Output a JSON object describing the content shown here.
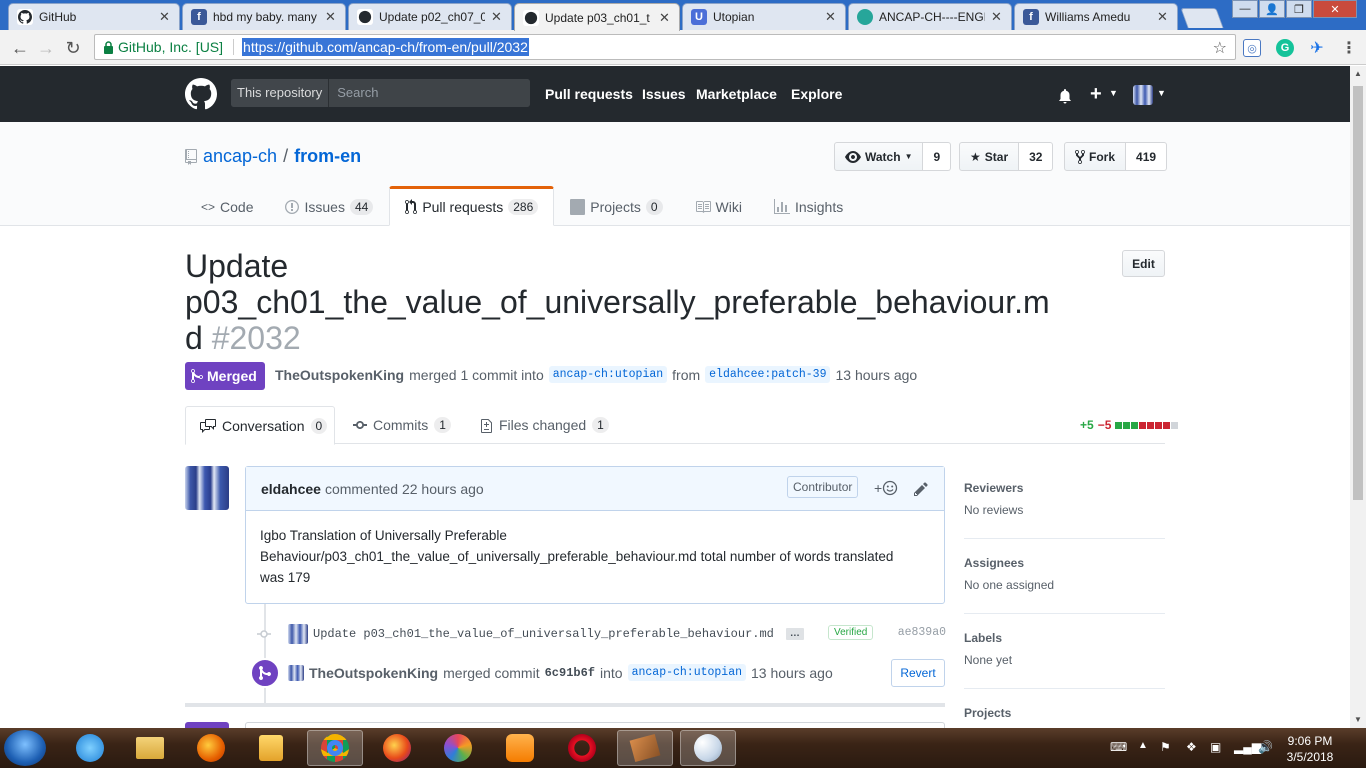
{
  "browser": {
    "tabs": [
      {
        "title": "GitHub",
        "icon": "github-icon"
      },
      {
        "title": "hbd my baby. many",
        "icon": "facebook-icon"
      },
      {
        "title": "Update p02_ch07_0",
        "icon": "github-icon"
      },
      {
        "title": "Update p03_ch01_t",
        "icon": "github-icon",
        "active": true
      },
      {
        "title": "Utopian",
        "icon": "utopian-icon"
      },
      {
        "title": "ANCAP-CH----ENGI",
        "icon": "ancap-icon"
      },
      {
        "title": "Williams Amedu",
        "icon": "facebook-icon"
      }
    ],
    "org": "GitHub, Inc. [US]",
    "url": "https://github.com/ancap-ch/from-en/pull/2032"
  },
  "header": {
    "scope": "This repository",
    "search_placeholder": "Search",
    "nav": [
      "Pull requests",
      "Issues",
      "Marketplace",
      "Explore"
    ]
  },
  "repo": {
    "owner": "ancap-ch",
    "name": "from-en",
    "watch": {
      "label": "Watch",
      "count": "9"
    },
    "star": {
      "label": "Star",
      "count": "32"
    },
    "fork": {
      "label": "Fork",
      "count": "419"
    },
    "nav": [
      {
        "label": "Code",
        "count": null
      },
      {
        "label": "Issues",
        "count": "44"
      },
      {
        "label": "Pull requests",
        "count": "286"
      },
      {
        "label": "Projects",
        "count": "0"
      },
      {
        "label": "Wiki",
        "count": null
      },
      {
        "label": "Insights",
        "count": null
      }
    ]
  },
  "pr": {
    "title_line1": "Update",
    "title_line2": "p03_ch01_the_value_of_universally_preferable_behaviour.m",
    "title_line3": "d",
    "number": "#2032",
    "edit_label": "Edit",
    "state": "Merged",
    "merger": "TheOutspokenKing",
    "merged_text": "merged 1 commit into",
    "base": "ancap-ch:utopian",
    "from_text": "from",
    "head": "eldahcee:patch-39",
    "time": "13 hours ago",
    "tabs": [
      {
        "label": "Conversation",
        "count": "0"
      },
      {
        "label": "Commits",
        "count": "1"
      },
      {
        "label": "Files changed",
        "count": "1"
      }
    ],
    "additions": "+5",
    "deletions": "−5",
    "diff_blocks": [
      "#28a745",
      "#28a745",
      "#28a745",
      "#cb2431",
      "#cb2431",
      "#cb2431",
      "#cb2431",
      "#d1d5da"
    ]
  },
  "comment": {
    "author": "eldahcee",
    "action": "commented 22 hours ago",
    "badge": "Contributor",
    "body_line1": "Igbo Translation of Universally Preferable",
    "body_line2": "Behaviour/p03_ch01_the_value_of_universally_preferable_behaviour.md total number of words translated",
    "body_line3": "was 179"
  },
  "commit": {
    "message": "Update p03_ch01_the_value_of_universally_preferable_behaviour.md",
    "expander": "…",
    "verified": "Verified",
    "sha": "ae839a0"
  },
  "merge_event": {
    "user": "TheOutspokenKing",
    "text": "merged commit",
    "sha": "6c91b6f",
    "into": "into",
    "base": "ancap-ch:utopian",
    "time": "13 hours ago",
    "revert": "Revert"
  },
  "sidebar": [
    {
      "heading": "Reviewers",
      "value": "No reviews"
    },
    {
      "heading": "Assignees",
      "value": "No one assigned"
    },
    {
      "heading": "Labels",
      "value": "None yet"
    },
    {
      "heading": "Projects",
      "value": ""
    }
  ],
  "taskbar": {
    "time": "9:06 PM",
    "date": "3/5/2018"
  },
  "colors": {
    "merged": "#6f42c1",
    "link": "#0366d6",
    "header": "#24292e"
  }
}
